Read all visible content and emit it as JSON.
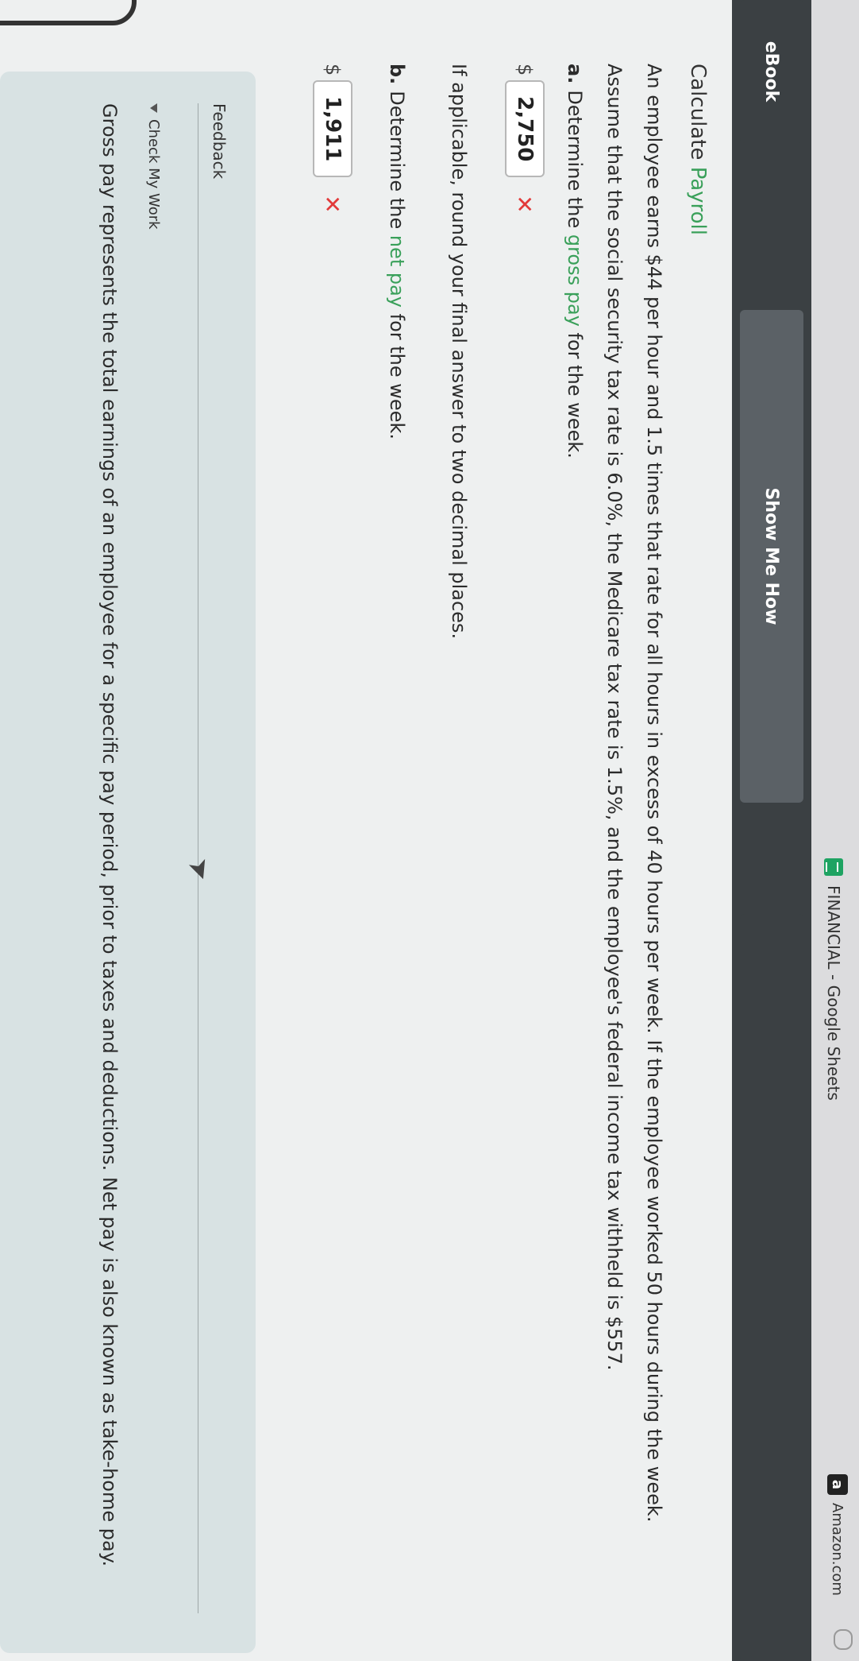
{
  "browser": {
    "tab_title": "FINANCIAL - Google Sheets",
    "bookmark_label": "Amazon.com",
    "bookmark_icon_letter": "a"
  },
  "tabs": {
    "ebook": "eBook",
    "show_me_how": "Show Me How"
  },
  "problem": {
    "title_prefix": "Calculate ",
    "title_link": "Payroll",
    "para1": "An employee earns $44 per hour and 1.5 times that rate for all hours in excess of 40 hours per week. If the employee worked 50 hours during the week.",
    "para2": "Assume that the social security tax rate is 6.0%, the Medicare tax rate is 1.5%, and the employee's federal income tax withheld is $557.",
    "qa_label": "a.",
    "qa_pre": "Determine the ",
    "qa_link": "gross pay",
    "qa_post": " for the week.",
    "answer_a_currency": "$",
    "answer_a_value": "2,750",
    "answer_a_status": "✕",
    "rounding_note": "If applicable, round your final answer to two decimal places.",
    "qb_label": "b.",
    "qb_pre": "Determine the ",
    "qb_link": "net pay",
    "qb_post": " for the week.",
    "answer_b_currency": "$",
    "answer_b_value": "1,911",
    "answer_b_status": "✕"
  },
  "feedback": {
    "title": "Feedback",
    "check_my_work": "Check My Work",
    "body": "Gross pay represents the total earnings of an employee for a specific pay period, prior to taxes and deductions. Net pay is also known as take-home pay."
  }
}
